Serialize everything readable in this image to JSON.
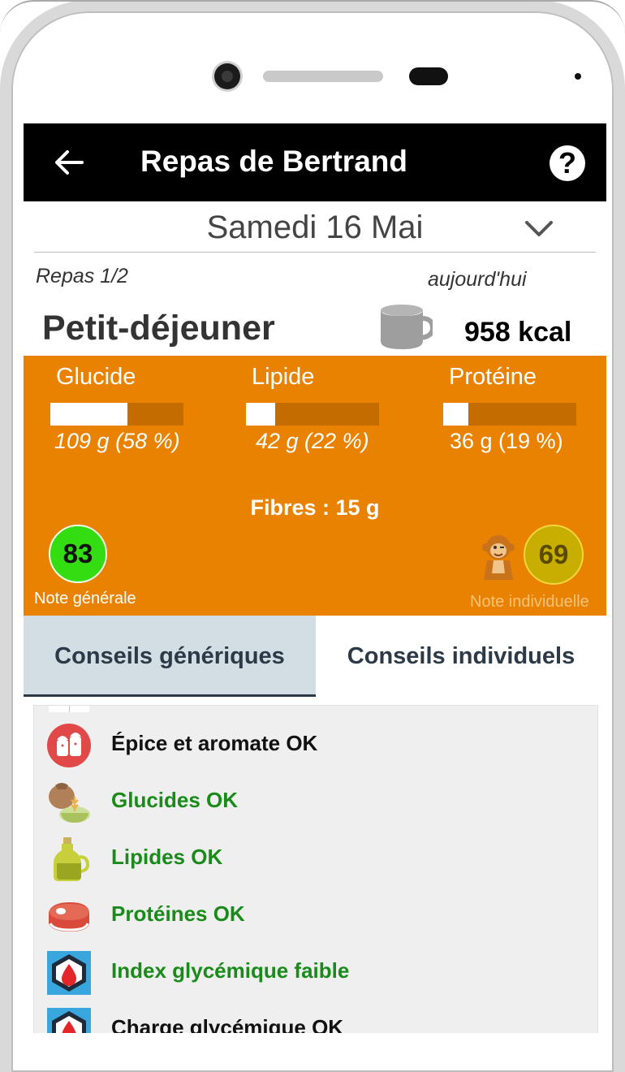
{
  "app": {
    "title": "Repas de Bertrand"
  },
  "date": {
    "label": "Samedi 16 Mai"
  },
  "meal": {
    "index_label": "Repas 1/2",
    "day_label": "aujourd'hui",
    "name": "Petit-déjeuner",
    "kcal": "958 kcal"
  },
  "macros": [
    {
      "label": "Glucide",
      "value": "109 g (58 %)",
      "fraction": 0.58
    },
    {
      "label": "Lipide",
      "value": "42 g (22 %)",
      "fraction": 0.22
    },
    {
      "label": "Protéine",
      "value": "36 g (19 %)",
      "fraction": 0.19
    }
  ],
  "fibres": "Fibres : 15 g",
  "scores": {
    "general": {
      "value": "83",
      "label": "Note générale",
      "color": "#33dd11"
    },
    "individual": {
      "value": "69",
      "label": "Note individuelle",
      "color": "#c7ae00"
    }
  },
  "tabs": [
    {
      "label": "Conseils génériques",
      "active": true
    },
    {
      "label": "Conseils individuels",
      "active": false
    }
  ],
  "advice": [
    {
      "icon": "salt-pepper-icon",
      "text": "Épice et aromate OK",
      "status": "neutral"
    },
    {
      "icon": "carbs-sack-icon",
      "text": "Glucides OK",
      "status": "ok"
    },
    {
      "icon": "oil-bottle-icon",
      "text": "Lipides OK",
      "status": "ok"
    },
    {
      "icon": "steak-icon",
      "text": "Protéines OK",
      "status": "ok"
    },
    {
      "icon": "glycemic-index-icon",
      "text": "Index glycémique faible",
      "status": "ok"
    },
    {
      "icon": "glycemic-load-icon",
      "text": "Charge glycémique OK",
      "status": "neutral"
    }
  ],
  "colors": {
    "appbar": "#000000",
    "panel": "#e88200",
    "ok_text": "#1a8a1a",
    "tab_active_bg": "#d2dde4"
  }
}
